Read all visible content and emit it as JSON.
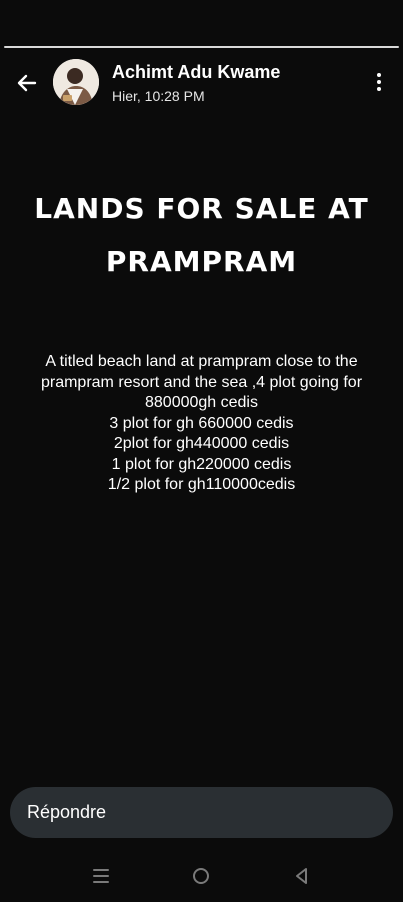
{
  "story": {
    "progress_segments": 1,
    "author_name": "Achimt Adu Kwame",
    "timestamp": "Hier, 10:28 PM",
    "headline_lines": [
      "LANDS FOR SALE AT",
      "PRAMPRAM"
    ],
    "body_lines": [
      "A  titled beach land at prampram close to the",
      "prampram resort and the sea ,4 plot going for",
      "880000gh cedis",
      "3 plot for gh 660000 cedis",
      "2plot for gh440000 cedis",
      "1 plot for gh220000 cedis",
      "1/2 plot for gh110000cedis"
    ]
  },
  "reply": {
    "placeholder": "Répondre"
  },
  "icons": {
    "back": "back-arrow-icon",
    "more": "more-vertical-icon",
    "nav_recents": "menu-lines-icon",
    "nav_home": "circle-home-icon",
    "nav_back": "triangle-back-icon"
  },
  "colors": {
    "background": "#0b0b0b",
    "text": "#ffffff",
    "reply_bar": "#2a2f33",
    "nav_icons": "#7a7a7a"
  }
}
